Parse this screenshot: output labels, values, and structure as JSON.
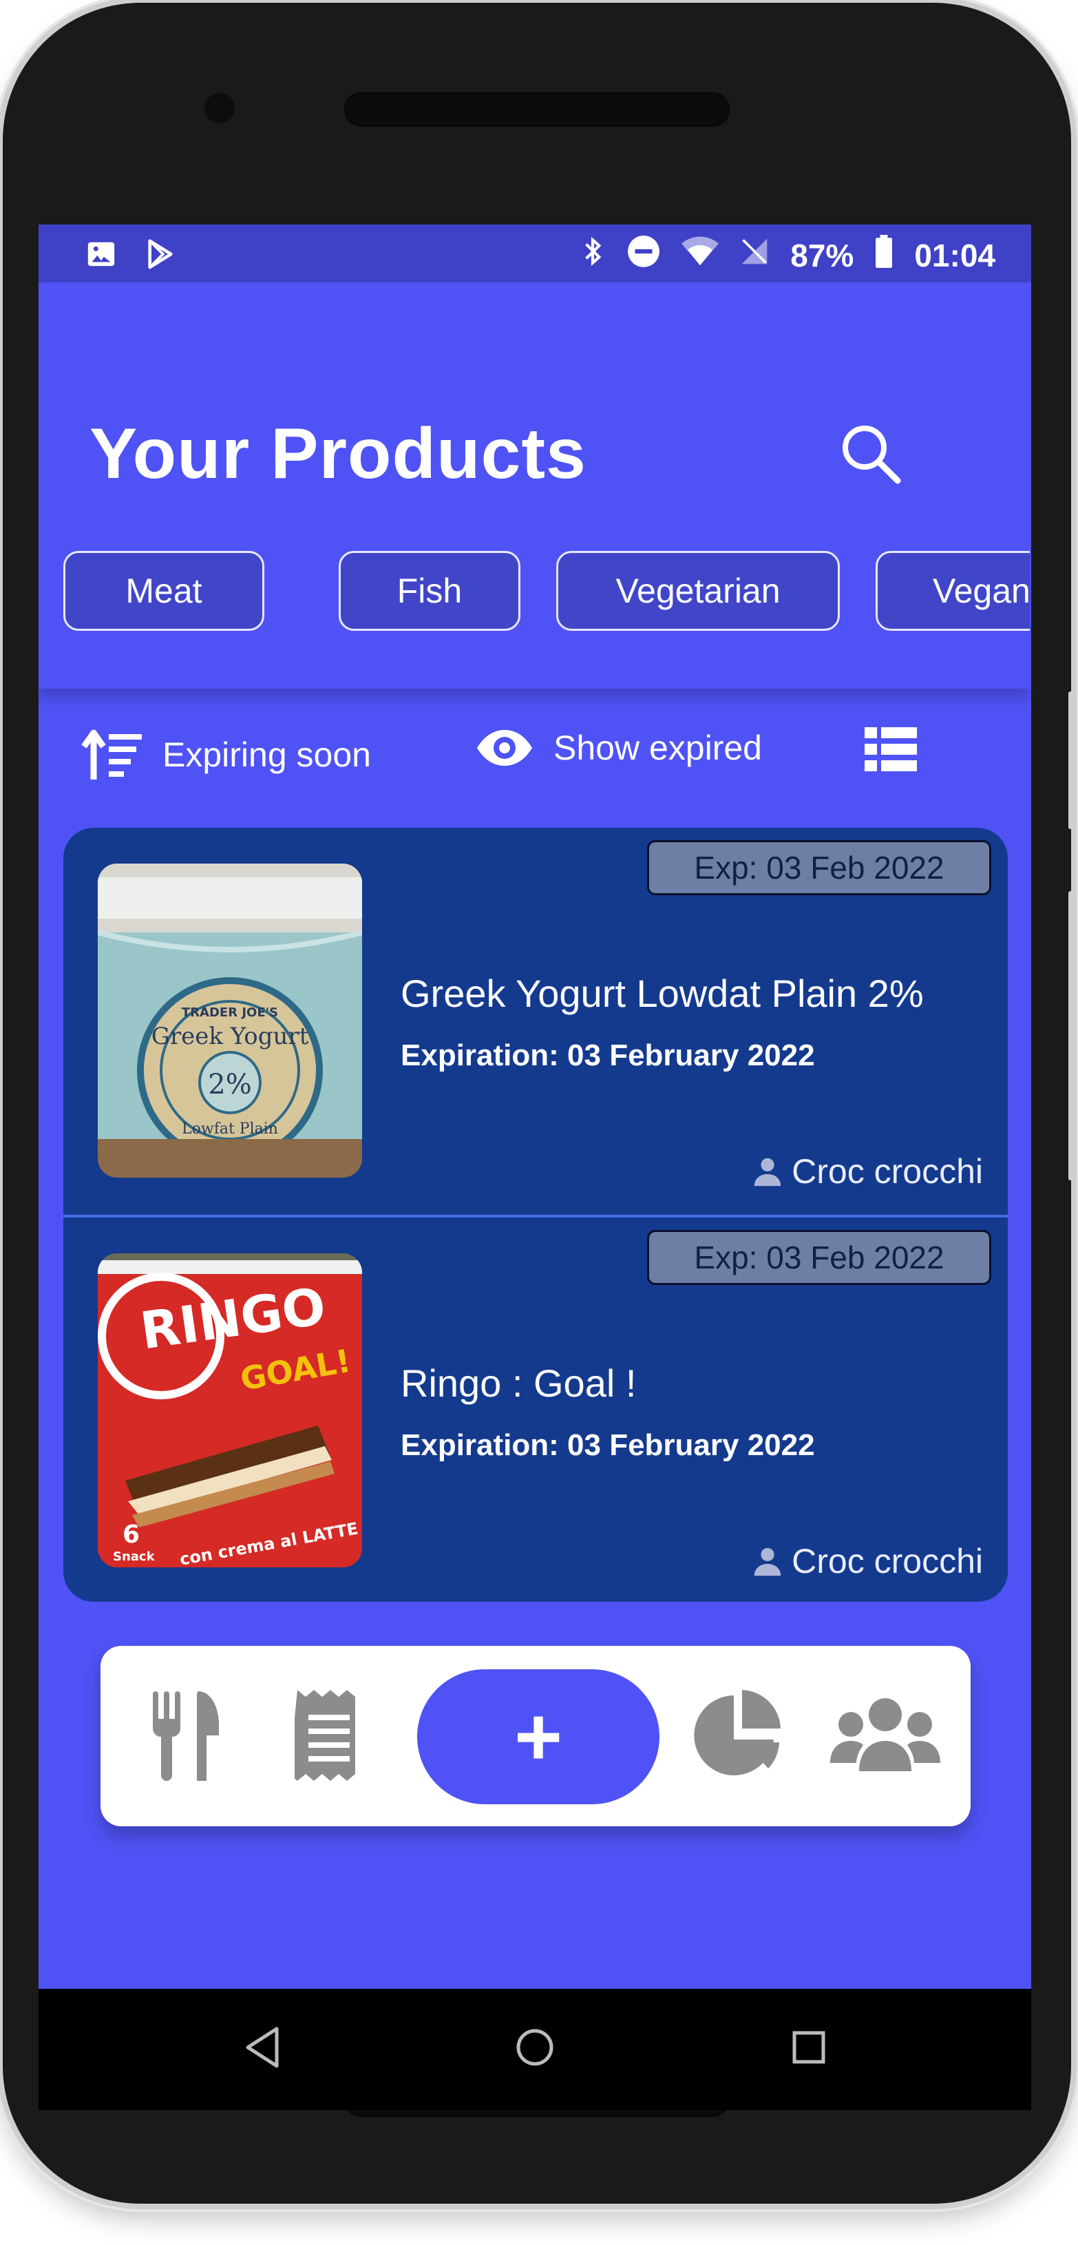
{
  "status_bar": {
    "battery": "87%",
    "time": "01:04"
  },
  "header": {
    "title": "Your Products"
  },
  "categories": [
    {
      "label": "Meat"
    },
    {
      "label": "Fish"
    },
    {
      "label": "Vegetarian"
    },
    {
      "label": "Vegan"
    }
  ],
  "toolbar": {
    "sort_label": "Expiring soon",
    "expired_label": "Show expired"
  },
  "products": [
    {
      "badge": "Exp: 03 Feb 2022",
      "name": "Greek Yogurt Lowdat Plain 2%",
      "expiration": "Expiration: 03 February 2022",
      "owner": "Croc crocchi",
      "image_text": {
        "brand": "TRADER JOE'S",
        "title": "Greek Yogurt",
        "percent": "2%",
        "subtitle": "Lowfat Plain"
      }
    },
    {
      "badge": "Exp: 03 Feb 2022",
      "name": "Ringo : Goal !",
      "expiration": "Expiration: 03 February 2022",
      "owner": "Croc crocchi",
      "image_text": {
        "brand": "RINGO",
        "title": "GOAL!",
        "count": "6",
        "count_label": "Snack",
        "tagline": "con crema al LATTE"
      }
    }
  ],
  "bottom_nav": {
    "add_label": "+"
  },
  "colors": {
    "primary": "#4f53f5",
    "status_bar": "#3f41c6",
    "card_bg": "#143a8e",
    "badge_bg": "#6e7fa5",
    "nav_icon": "#8c8c8c"
  },
  "icons": [
    "image-icon",
    "play-store-icon",
    "bluetooth-icon",
    "do-not-disturb-icon",
    "wifi-icon",
    "no-sim-icon",
    "battery-icon",
    "search-icon",
    "sort-icon",
    "eye-icon",
    "list-view-icon",
    "person-icon",
    "utensils-icon",
    "receipt-icon",
    "plus-icon",
    "pie-chart-icon",
    "users-icon",
    "back-icon",
    "home-icon",
    "recents-icon"
  ]
}
